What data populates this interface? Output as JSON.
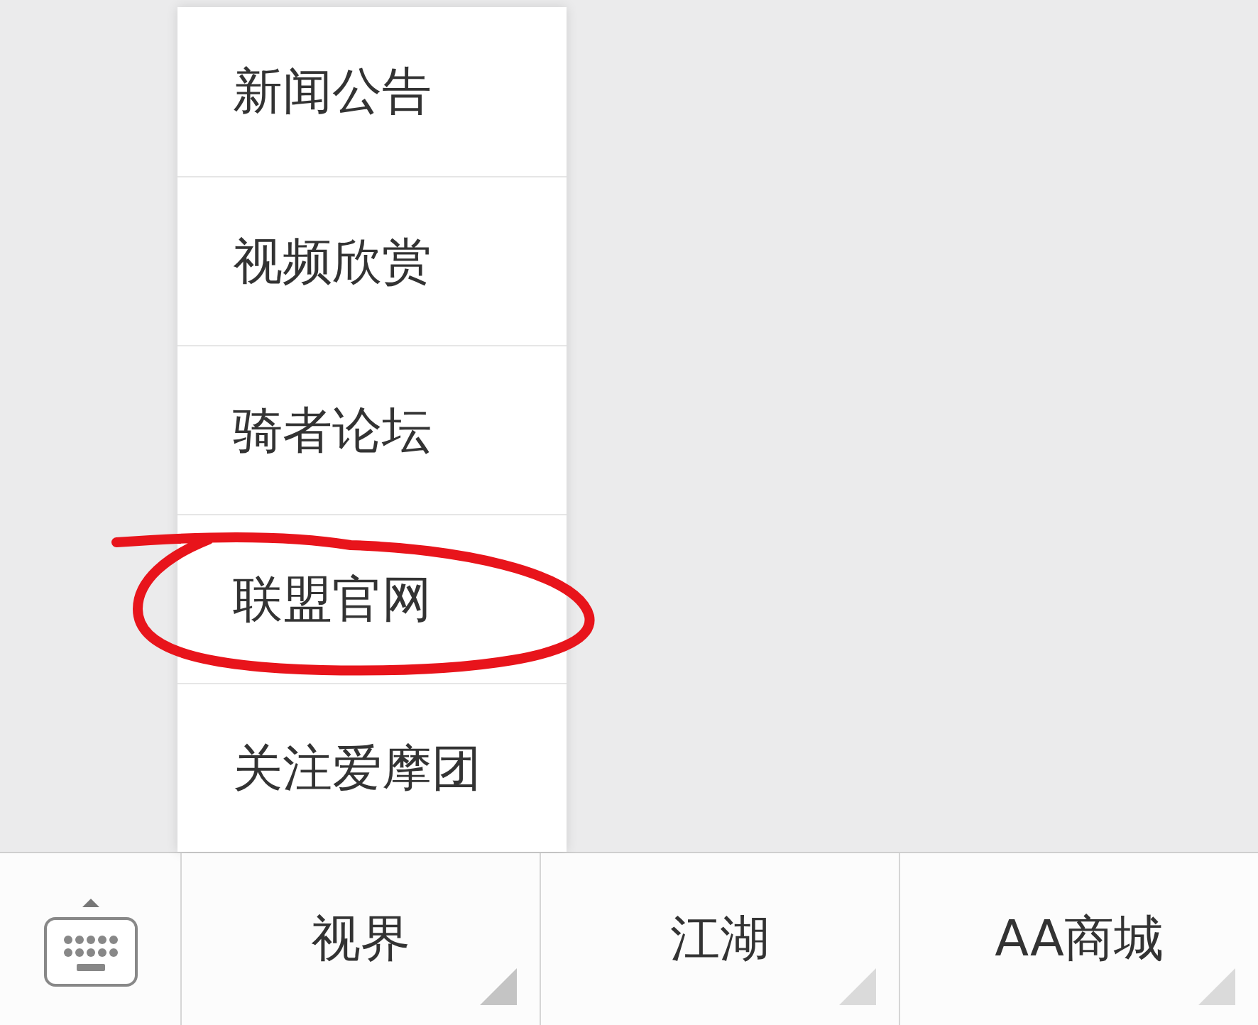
{
  "submenu": {
    "items": [
      {
        "label": "新闻公告",
        "highlighted": false
      },
      {
        "label": "视频欣赏",
        "highlighted": false
      },
      {
        "label": "骑者论坛",
        "highlighted": false
      },
      {
        "label": "联盟官网",
        "highlighted": true
      },
      {
        "label": "关注爱摩团",
        "highlighted": false
      }
    ]
  },
  "menu_bar": {
    "items": [
      {
        "label": "视界",
        "expanded": true
      },
      {
        "label": "江湖",
        "expanded": false
      },
      {
        "label": "AA商城",
        "expanded": false
      }
    ]
  }
}
